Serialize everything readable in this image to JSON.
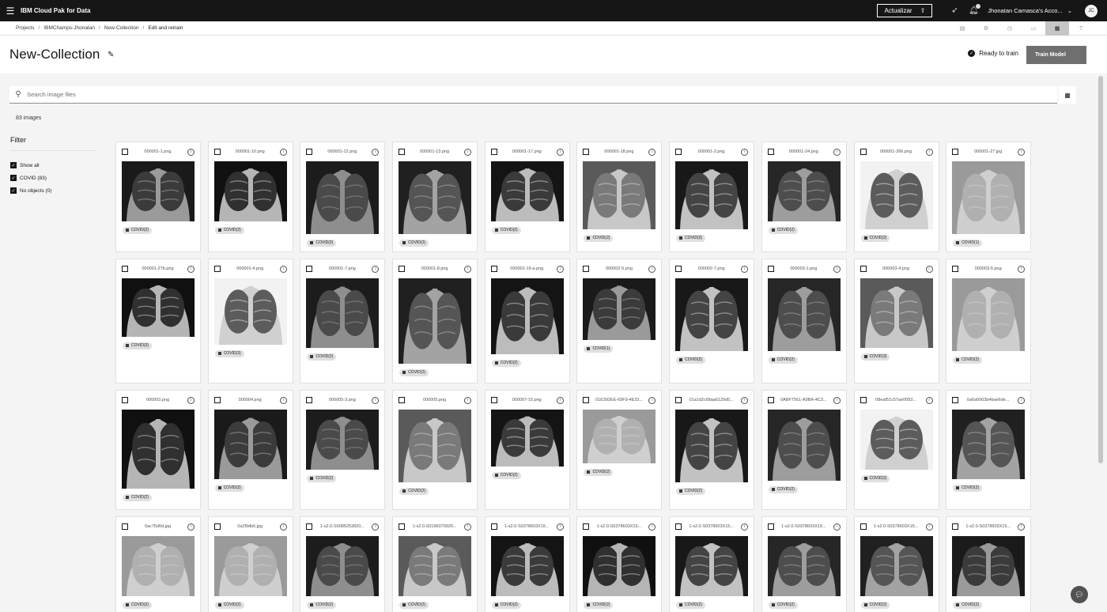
{
  "header": {
    "brand": "IBM Cloud Pak for Data",
    "upgrade_label": "Actualizar",
    "account_label": "Jhonatan Camasca's Acco...",
    "avatar_initials": "JC"
  },
  "breadcrumb": {
    "items": [
      "Projects",
      "IBMChamps-Jhonatan",
      "New-Collection",
      "Edit and retrain"
    ]
  },
  "page": {
    "title": "New-Collection",
    "status_text": "Ready to train",
    "train_button": "Train Model"
  },
  "search": {
    "placeholder": "Search image files"
  },
  "image_count": "83 images",
  "filter": {
    "title": "Filter",
    "items": [
      {
        "label": "Show all",
        "checked": true
      },
      {
        "label": "COVID (83)",
        "checked": true
      },
      {
        "label": "No objects (0)",
        "checked": true
      }
    ]
  },
  "cards": [
    {
      "name": "000001-1.png",
      "tag": "COVID(2)",
      "img_h": 76,
      "tone": 0
    },
    {
      "name": "000001-10.png",
      "tag": "COVID(2)",
      "img_h": 76,
      "tone": 1
    },
    {
      "name": "000001-12.png",
      "tag": "COVID(2)",
      "img_h": 92,
      "tone": 2
    },
    {
      "name": "000001-13.png",
      "tag": "COVID(2)",
      "img_h": 92,
      "tone": 3
    },
    {
      "name": "000001-17.png",
      "tag": "COVID(2)",
      "img_h": 76,
      "tone": 4
    },
    {
      "name": "000001-18.png",
      "tag": "COVID(2)",
      "img_h": 86,
      "tone": 5
    },
    {
      "name": "000001-2.png",
      "tag": "COVID(3)",
      "img_h": 86,
      "tone": 6
    },
    {
      "name": "000001-24.png",
      "tag": "COVID(2)",
      "img_h": 76,
      "tone": 7
    },
    {
      "name": "000001-266.png",
      "tag": "COVID(2)",
      "img_h": 86,
      "tone": 8
    },
    {
      "name": "000001-27.jpg",
      "tag": "COVID(1)",
      "img_h": 92,
      "tone": 9
    },
    {
      "name": "000001-27b.png",
      "tag": "COVID(3)",
      "img_h": 74,
      "tone": 1
    },
    {
      "name": "000001-4.png",
      "tag": "COVID(3)",
      "img_h": 84,
      "tone": 8
    },
    {
      "name": "000001-7.png",
      "tag": "COVID(2)",
      "img_h": 88,
      "tone": 2
    },
    {
      "name": "000001-8.png",
      "tag": "COVID(2)",
      "img_h": 108,
      "tone": 3
    },
    {
      "name": "000002-19-a.png",
      "tag": "COVID(2)",
      "img_h": 96,
      "tone": 4
    },
    {
      "name": "000002-5.png",
      "tag": "COVID(1)",
      "img_h": 78,
      "tone": 0
    },
    {
      "name": "000002-7.png",
      "tag": "COVID(2)",
      "img_h": 92,
      "tone": 6
    },
    {
      "name": "000003-1.png",
      "tag": "COVID(2)",
      "img_h": 92,
      "tone": 7
    },
    {
      "name": "000003-4.png",
      "tag": "COVID(3)",
      "img_h": 88,
      "tone": 5
    },
    {
      "name": "000003-5.png",
      "tag": "COVID(2)",
      "img_h": 92,
      "tone": 9
    },
    {
      "name": "000003.png",
      "tag": "COVID(2)",
      "img_h": 100,
      "tone": 1
    },
    {
      "name": "000004.png",
      "tag": "COVID(2)",
      "img_h": 88,
      "tone": 0
    },
    {
      "name": "000005-3.png",
      "tag": "COVID(2)",
      "img_h": 76,
      "tone": 2
    },
    {
      "name": "000005.png",
      "tag": "COVID(2)",
      "img_h": 92,
      "tone": 5
    },
    {
      "name": "000007-15.png",
      "tag": "COVID(2)",
      "img_h": 72,
      "tone": 4
    },
    {
      "name": "01E392EE-69F9-4E33...",
      "tag": "COVID(2)",
      "img_h": 68,
      "tone": 9
    },
    {
      "name": "01a1d2c68aa6120d5...",
      "tag": "COVID(2)",
      "img_h": 92,
      "tone": 6
    },
    {
      "name": "0ABF7561-A9BA-4C3...",
      "tag": "COVID(2)",
      "img_h": 90,
      "tone": 7
    },
    {
      "name": "08eaf51c57ae0093...",
      "tag": "COVID(2)",
      "img_h": 76,
      "tone": 8
    },
    {
      "name": "0a6a0063b4bae6de...",
      "tag": "COVID(2)",
      "img_h": 88,
      "tone": 3
    },
    {
      "name": "0ac75d0d.jpg",
      "tag": "COVID(2)",
      "img_h": 76,
      "tone": 9
    },
    {
      "name": "0a2f9db6.jpg",
      "tag": "COVID(2)",
      "img_h": 76,
      "tone": 9
    },
    {
      "name": "1-s2.0-S0085253820...",
      "tag": "COVID(2)",
      "img_h": 76,
      "tone": 2
    },
    {
      "name": "1-s2.0-S0196070920...",
      "tag": "COVID(2)",
      "img_h": 76,
      "tone": 5
    },
    {
      "name": "1-s2.0-S0378603X15...",
      "tag": "COVID(2)",
      "img_h": 76,
      "tone": 4
    },
    {
      "name": "1-s2.0-S0378603X15...",
      "tag": "COVID(2)",
      "img_h": 76,
      "tone": 1
    },
    {
      "name": "1-s2.0-S0378603X15...",
      "tag": "COVID(2)",
      "img_h": 76,
      "tone": 6
    },
    {
      "name": "1-s2.0-S0378603X15...",
      "tag": "COVID(2)",
      "img_h": 76,
      "tone": 7
    },
    {
      "name": "1-s2.0-S0378603X15...",
      "tag": "COVID(2)",
      "img_h": 76,
      "tone": 3
    },
    {
      "name": "1-s2.0-S0378603X15...",
      "tag": "COVID(2)",
      "img_h": 76,
      "tone": 0
    }
  ]
}
